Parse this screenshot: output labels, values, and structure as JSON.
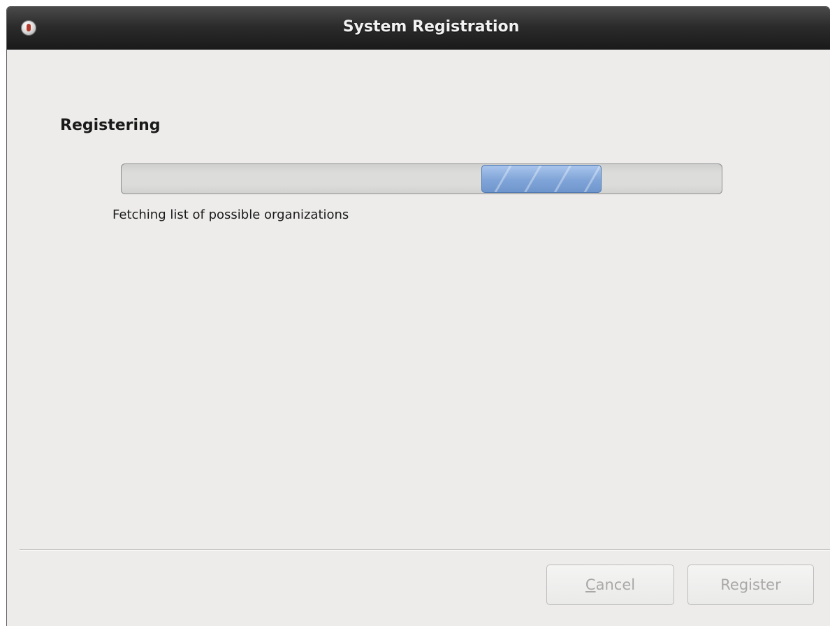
{
  "window": {
    "title": "System Registration"
  },
  "main": {
    "heading": "Registering",
    "status": "Fetching list of possible organizations",
    "progress": {
      "mode": "indeterminate",
      "pulse_start": 0.6,
      "pulse_end": 0.8,
      "fill_color": "#7fa4d8"
    }
  },
  "buttons": {
    "cancel": {
      "mnemonic": "C",
      "rest": "ancel",
      "enabled": false
    },
    "register": {
      "label": "Register",
      "enabled": false
    }
  }
}
